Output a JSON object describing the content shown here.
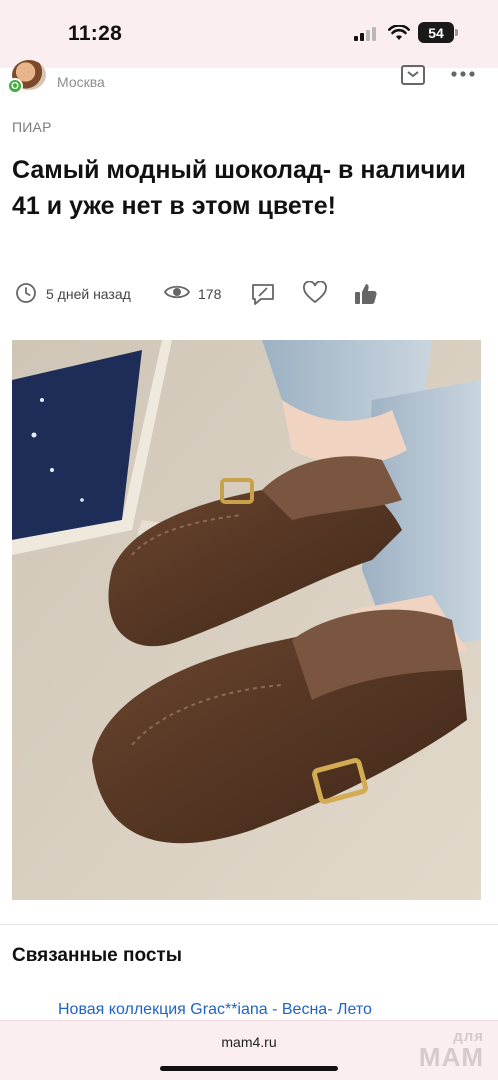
{
  "status_bar": {
    "time": "11:28",
    "battery": "54"
  },
  "author": {
    "online_badge": "O",
    "city": "Москва"
  },
  "post": {
    "category": "ПИАР",
    "title": "Самый модный шоколад- в наличии 41 и уже нет в этом цвете!",
    "posted_ago": "5 дней назад",
    "views": "178"
  },
  "related": {
    "heading": "Связанные посты",
    "items": [
      {
        "title": "Новая коллекция Grac**iana - Весна- Лето"
      }
    ]
  },
  "browser": {
    "url": "mam4.ru",
    "watermark_top": "для",
    "watermark_bottom": "МАМ"
  },
  "colors": {
    "status_bg": "#fbeef0",
    "link": "#1f63c6",
    "online": "#3fae3a",
    "shoe_suede": "#5a3a24"
  },
  "icons": [
    "signal-icon",
    "wifi-icon",
    "bookmark-icon",
    "more-icon",
    "clock-icon",
    "eye-icon",
    "comment-icon",
    "heart-icon",
    "thumbs-up-icon"
  ]
}
